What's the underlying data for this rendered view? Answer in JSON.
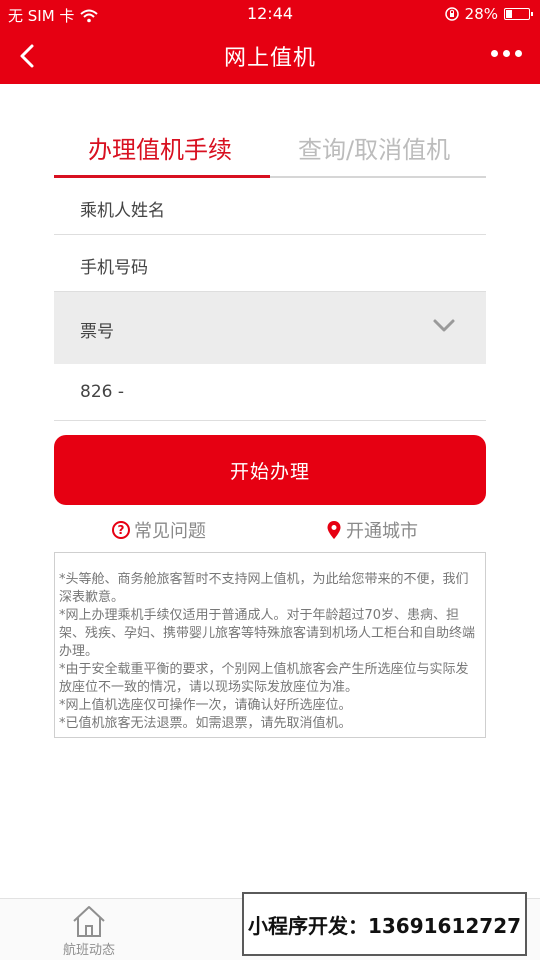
{
  "status_bar": {
    "carrier": "无 SIM 卡",
    "time": "12:44",
    "battery": "28%",
    "battery_level": 0.28
  },
  "nav": {
    "title": "网上值机",
    "back_icon": "chevron-left-icon",
    "more_icon": "more-dots-icon"
  },
  "tabs": [
    {
      "label": "办理值机手续",
      "active": true
    },
    {
      "label": "查询/取消值机",
      "active": false
    }
  ],
  "form": {
    "passenger_name_placeholder": "乘机人姓名",
    "phone_placeholder": "手机号码",
    "ticket_type": "票号",
    "ticket_number_value": "826 -"
  },
  "start_button": "开始办理",
  "links": {
    "faq": "常见问题",
    "cities": "开通城市"
  },
  "notice": [
    "*头等舱、商务舱旅客暂时不支持网上值机，为此给您带来的不便，我们深表歉意。",
    "*网上办理乘机手续仅适用于普通成人。对于年龄超过70岁、患病、担架、残疾、孕妇、携带婴儿旅客等特殊旅客请到机场人工柜台和自助终端办理。",
    "*由于安全载重平衡的要求，个别网上值机旅客会产生所选座位与实际发放座位不一致的情况，请以现场实际发放座位为准。",
    "*网上值机选座仅可操作一次，请确认好所选座位。",
    "*已值机旅客无法退票。如需退票，请先取消值机。"
  ],
  "tabbar": {
    "flight_status": "航班动态"
  },
  "overlay": "小程序开发：13691612727",
  "colors": {
    "brand_red": "#e60012",
    "tab_active": "#d81020",
    "muted_text": "#8a8a8a"
  }
}
